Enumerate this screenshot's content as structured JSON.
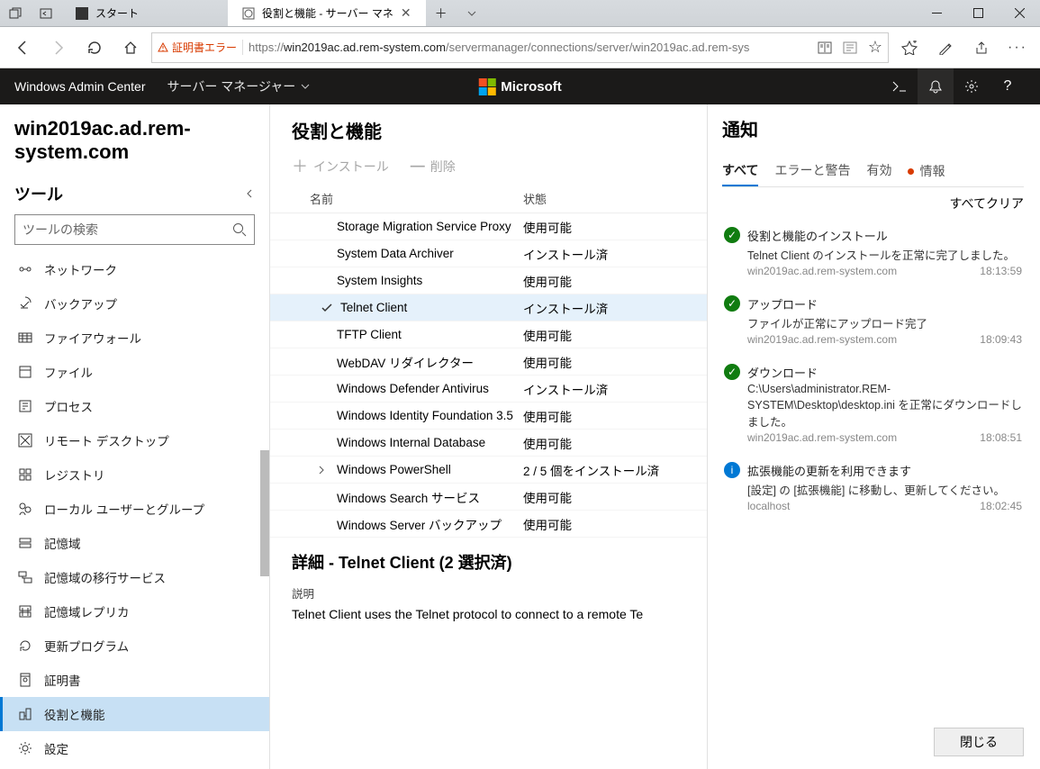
{
  "window": {
    "tab1_title": "スタート",
    "tab2_title": "役割と機能 - サーバー マネ"
  },
  "address": {
    "cert_error": "証明書エラー",
    "url_prefix": "https://",
    "url_host": "win2019ac.ad.rem-system.com",
    "url_path": "/servermanager/connections/server/win2019ac.ad.rem-sys"
  },
  "header": {
    "product": "Windows Admin Center",
    "context": "サーバー マネージャー",
    "brand": "Microsoft"
  },
  "host": "win2019ac.ad.rem-system.com",
  "tools": {
    "title": "ツール",
    "search_placeholder": "ツールの検索",
    "items": [
      {
        "label": "ネットワーク"
      },
      {
        "label": "バックアップ"
      },
      {
        "label": "ファイアウォール"
      },
      {
        "label": "ファイル"
      },
      {
        "label": "プロセス"
      },
      {
        "label": "リモート デスクトップ"
      },
      {
        "label": "レジストリ"
      },
      {
        "label": "ローカル ユーザーとグループ"
      },
      {
        "label": "記憶域"
      },
      {
        "label": "記憶域の移行サービス"
      },
      {
        "label": "記憶域レプリカ"
      },
      {
        "label": "更新プログラム"
      },
      {
        "label": "証明書"
      },
      {
        "label": "役割と機能"
      },
      {
        "label": "設定"
      }
    ],
    "selected_index": 13
  },
  "main": {
    "title": "役割と機能",
    "action_install": "インストール",
    "action_remove": "削除",
    "col_name": "名前",
    "col_state": "状態",
    "rows": [
      {
        "name": "Storage Migration Service Proxy",
        "state": "使用可能"
      },
      {
        "name": "System Data Archiver",
        "state": "インストール済"
      },
      {
        "name": "System Insights",
        "state": "使用可能"
      },
      {
        "name": "Telnet Client",
        "state": "インストール済",
        "selected": true,
        "checked": true
      },
      {
        "name": "TFTP Client",
        "state": "使用可能"
      },
      {
        "name": "WebDAV リダイレクター",
        "state": "使用可能"
      },
      {
        "name": "Windows Defender Antivirus",
        "state": "インストール済"
      },
      {
        "name": "Windows Identity Foundation 3.5",
        "state": "使用可能"
      },
      {
        "name": "Windows Internal Database",
        "state": "使用可能"
      },
      {
        "name": "Windows PowerShell",
        "state": "2 / 5 個をインストール済",
        "expandable": true
      },
      {
        "name": "Windows Search サービス",
        "state": "使用可能"
      },
      {
        "name": "Windows Server バックアップ",
        "state": "使用可能"
      }
    ],
    "details_title": "詳細 - Telnet Client (2 選択済)",
    "details_label": "説明",
    "details_text": "Telnet Client uses the Telnet protocol to connect to a remote Te"
  },
  "notifications": {
    "title": "通知",
    "tabs": {
      "all": "すべて",
      "err": "エラーと警告",
      "enabled": "有効",
      "info": "情報"
    },
    "clear_all": "すべてクリア",
    "items": [
      {
        "kind": "ok",
        "title": "役割と機能のインストール",
        "msg": "Telnet Client のインストールを正常に完了しました。",
        "host": "win2019ac.ad.rem-system.com",
        "time": "18:13:59"
      },
      {
        "kind": "ok",
        "title": "アップロード",
        "msg": "ファイルが正常にアップロード完了",
        "host": "win2019ac.ad.rem-system.com",
        "time": "18:09:43"
      },
      {
        "kind": "ok",
        "title": "ダウンロード",
        "msg": "C:\\Users\\administrator.REM-SYSTEM\\Desktop\\desktop.ini を正常にダウンロードしました。",
        "host": "win2019ac.ad.rem-system.com",
        "time": "18:08:51"
      },
      {
        "kind": "info",
        "title": "拡張機能の更新を利用できます",
        "msg": "[設定] の [拡張機能] に移動し、更新してください。",
        "host": "localhost",
        "time": "18:02:45"
      }
    ],
    "close": "閉じる"
  }
}
